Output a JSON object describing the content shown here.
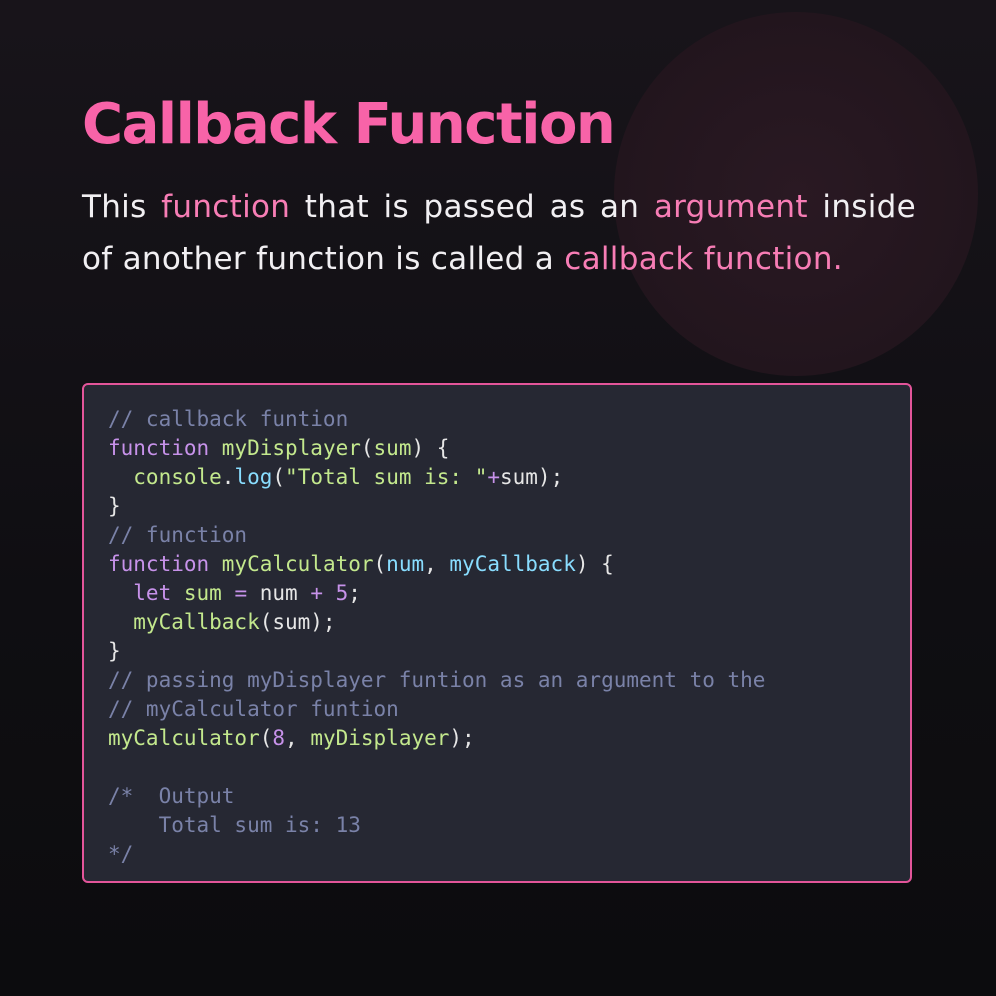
{
  "title": "Callback Function",
  "description": {
    "parts": [
      {
        "text": "This ",
        "highlight": false
      },
      {
        "text": "function",
        "highlight": true
      },
      {
        "text": " that is passed as an ",
        "highlight": false
      },
      {
        "text": "argument",
        "highlight": true
      },
      {
        "text": " inside of another function is called a ",
        "highlight": false
      },
      {
        "text": "callback function.",
        "highlight": true
      }
    ]
  },
  "colors": {
    "accent": "#f863a8",
    "highlight": "#f77db5",
    "code_border": "#e3559a",
    "code_bg": "#262833"
  },
  "code": {
    "lines": [
      [
        {
          "t": "// callback funtion",
          "c": "comment"
        }
      ],
      [
        {
          "t": "function ",
          "c": "kw"
        },
        {
          "t": "myDisplayer",
          "c": "fn"
        },
        {
          "t": "(",
          "c": "plain"
        },
        {
          "t": "sum",
          "c": "var"
        },
        {
          "t": ") {",
          "c": "plain"
        }
      ],
      [
        {
          "t": "  console",
          "c": "var"
        },
        {
          "t": ".",
          "c": "plain"
        },
        {
          "t": "log",
          "c": "prop"
        },
        {
          "t": "(",
          "c": "plain"
        },
        {
          "t": "\"Total sum is: \"",
          "c": "str"
        },
        {
          "t": "+",
          "c": "op"
        },
        {
          "t": "sum);",
          "c": "plain"
        }
      ],
      [
        {
          "t": "}",
          "c": "plain"
        }
      ],
      [
        {
          "t": "// function",
          "c": "comment"
        }
      ],
      [
        {
          "t": "function ",
          "c": "kw"
        },
        {
          "t": "myCalculator",
          "c": "fn"
        },
        {
          "t": "(",
          "c": "plain"
        },
        {
          "t": "num",
          "c": "param"
        },
        {
          "t": ", ",
          "c": "plain"
        },
        {
          "t": "myCallback",
          "c": "param"
        },
        {
          "t": ") {",
          "c": "plain"
        }
      ],
      [
        {
          "t": "  let ",
          "c": "kw"
        },
        {
          "t": "sum ",
          "c": "var"
        },
        {
          "t": "= ",
          "c": "op"
        },
        {
          "t": "num ",
          "c": "plain"
        },
        {
          "t": "+ ",
          "c": "op"
        },
        {
          "t": "5",
          "c": "num"
        },
        {
          "t": ";",
          "c": "plain"
        }
      ],
      [
        {
          "t": "  myCallback",
          "c": "fn"
        },
        {
          "t": "(sum);",
          "c": "plain"
        }
      ],
      [
        {
          "t": "}",
          "c": "plain"
        }
      ],
      [
        {
          "t": "// passing myDisplayer funtion as an argument to the",
          "c": "comment"
        }
      ],
      [
        {
          "t": "// myCalculator funtion",
          "c": "comment"
        }
      ],
      [
        {
          "t": "myCalculator",
          "c": "fn"
        },
        {
          "t": "(",
          "c": "plain"
        },
        {
          "t": "8",
          "c": "num"
        },
        {
          "t": ", ",
          "c": "plain"
        },
        {
          "t": "myDisplayer",
          "c": "var"
        },
        {
          "t": ");",
          "c": "plain"
        }
      ],
      [],
      [
        {
          "t": "/*  Output",
          "c": "comment"
        }
      ],
      [
        {
          "t": "    Total sum is: 13",
          "c": "comment"
        }
      ],
      [
        {
          "t": "*/",
          "c": "comment"
        }
      ]
    ]
  }
}
